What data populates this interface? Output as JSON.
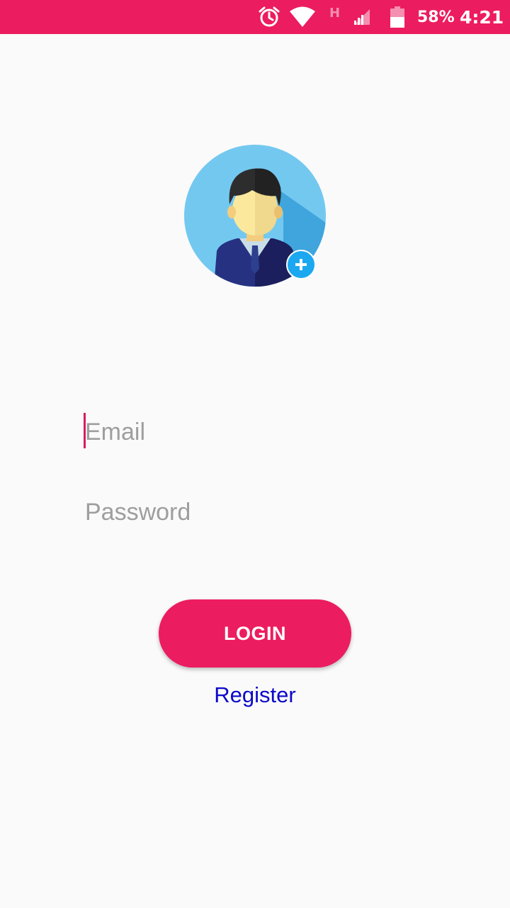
{
  "status_bar": {
    "network_type": "H",
    "battery_percent": "58%",
    "time": "4:21",
    "icons": [
      "alarm-icon",
      "wifi-icon",
      "signal-icon",
      "battery-icon"
    ]
  },
  "avatar": {
    "icon": "user-avatar-icon",
    "add_icon": "plus-icon"
  },
  "form": {
    "email_placeholder": "Email",
    "email_value": "",
    "password_placeholder": "Password",
    "password_value": ""
  },
  "actions": {
    "login_label": "LOGIN",
    "register_label": "Register"
  },
  "colors": {
    "accent": "#ec1c60",
    "link": "#0b09c9",
    "avatar_bg": "#73c8f0",
    "add_badge": "#1ba8f0"
  }
}
